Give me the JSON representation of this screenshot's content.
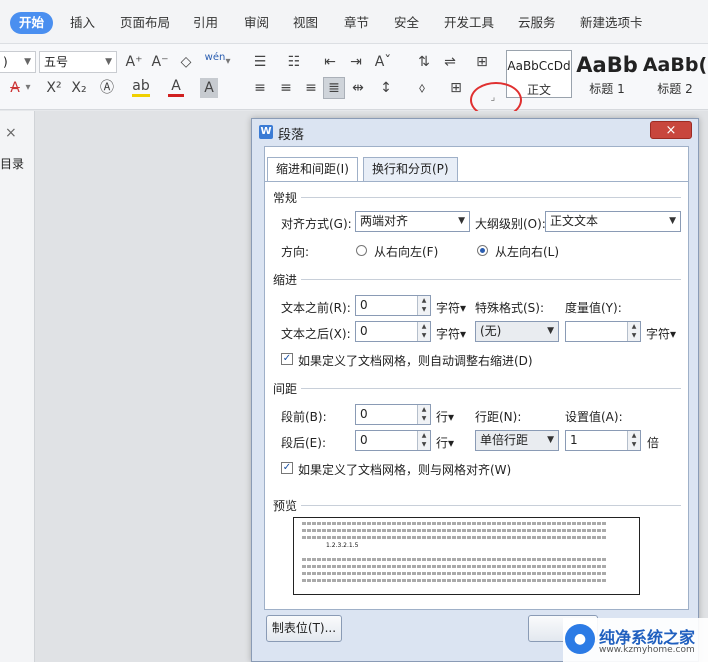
{
  "ribbon": {
    "tabs": [
      "开始",
      "插入",
      "页面布局",
      "引用",
      "审阅",
      "视图",
      "章节",
      "安全",
      "开发工具",
      "云服务",
      "新建选项卡"
    ],
    "active_tab": "开始"
  },
  "toolbar": {
    "font_name": ")",
    "font_size": "五号",
    "pinyin_glyph": "wén",
    "styles": [
      {
        "sample": "AaBbCcDd",
        "name": "正文"
      },
      {
        "sample": "AaBb",
        "name": "标题 1"
      },
      {
        "sample": "AaBb(",
        "name": "标题 2"
      }
    ]
  },
  "leftpane": {
    "close": "×",
    "label": "目录"
  },
  "dialog": {
    "title": "段落",
    "close": "×",
    "tabs": [
      "缩进和间距(I)",
      "换行和分页(P)"
    ],
    "general": {
      "heading": "常规",
      "align_label": "对齐方式(G):",
      "align_value": "两端对齐",
      "outline_label": "大纲级别(O):",
      "outline_value": "正文文本",
      "direction_label": "方向:",
      "rtl_label": "从右向左(F)",
      "ltr_label": "从左向右(L)"
    },
    "indent": {
      "heading": "缩进",
      "before_label": "文本之前(R):",
      "before_value": "0",
      "before_unit": "字符▾",
      "after_label": "文本之后(X):",
      "after_value": "0",
      "after_unit": "字符▾",
      "special_label": "特殊格式(S):",
      "special_value": "(无)",
      "measure_label": "度量值(Y):",
      "measure_value": "",
      "measure_unit": "字符▾",
      "auto_adjust": "如果定义了文档网格，则自动调整右缩进(D)"
    },
    "spacing": {
      "heading": "间距",
      "before_label": "段前(B):",
      "before_value": "0",
      "before_unit": "行▾",
      "after_label": "段后(E):",
      "after_value": "0",
      "after_unit": "行▾",
      "line_label": "行距(N):",
      "line_value": "单倍行距",
      "setting_label": "设置值(A):",
      "setting_value": "1",
      "setting_unit": "倍",
      "snap_grid": "如果定义了文档网格，则与网格对齐(W)"
    },
    "preview": {
      "heading": "预览",
      "sample_text": "1.2.3.2.1.5"
    },
    "tabs_button": "制表位(T)..."
  },
  "watermark": {
    "title": "纯净系统之家",
    "url": "www.kzmyhome.com"
  },
  "colors": {
    "accent": "#4a8ff0",
    "callout": "#e03030",
    "dialog_bg": "#dbe4f2",
    "close_red": "#c8463d"
  }
}
